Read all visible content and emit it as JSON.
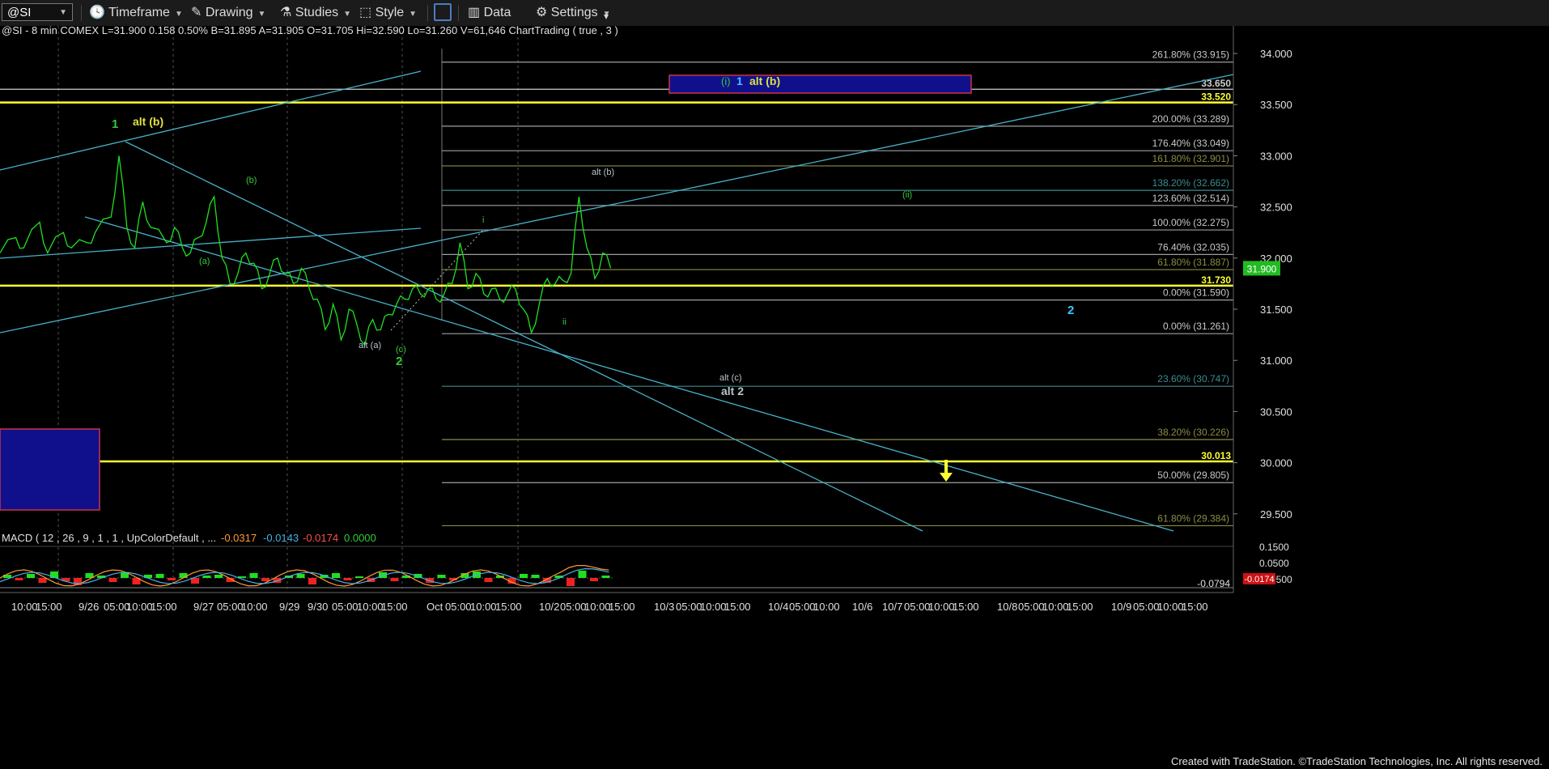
{
  "toolbar": {
    "symbol": "@SI",
    "timeframe": "Timeframe",
    "drawing": "Drawing",
    "studies": "Studies",
    "style": "Style",
    "data": "Data",
    "settings": "Settings"
  },
  "header_line": "@SI - 8 min  COMEX  L=31.900  0.158  0.50%  B=31.895  A=31.905  O=31.705  Hi=32.590  Lo=31.260  V=61,646  ChartTrading ( true , 3 )",
  "macd_header": {
    "label": "MACD ( 12 , 26 , 9 , 1 , 1 , UpColorDefault , ...",
    "v1": "-0.0317",
    "v2": "-0.0143",
    "v3": "-0.0174",
    "v4": "0.0000"
  },
  "footer": "Created with TradeStation. ©TradeStation Technologies, Inc. All rights reserved.",
  "colors": {
    "price": "#1fe01f",
    "trendline": "#48b0c8",
    "support": "#ffff33",
    "fib_grey": "#9aa0a6",
    "fib_olive": "#8c8c44",
    "fib_teal": "#3c8c90",
    "box": "#10108c",
    "wave_green": "#33cc33",
    "wave_yellow": "#e0e040",
    "wave_cyan": "#3cc8ff"
  },
  "chart_data": {
    "type": "line",
    "symbol": "@SI",
    "interval": "8 min",
    "ylim": [
      28.9,
      34.2
    ],
    "price_ticks": [
      34.0,
      33.5,
      33.0,
      32.5,
      32.0,
      31.5,
      31.0,
      30.5,
      30.0,
      29.5
    ],
    "price_tick_labels": [
      "34.000",
      "33.500",
      "33.000",
      "32.500",
      "32.000",
      "31.500",
      "31.000",
      "30.500",
      "30.000",
      "29.500"
    ],
    "x_labels": [
      "10:00",
      "15:00",
      "9/26",
      "05:00",
      "10:00",
      "15:00",
      "9/27",
      "05:00",
      "10:00",
      "9/29",
      "9/30",
      "05:00",
      "10:00",
      "15:00",
      "Oct",
      "05:00",
      "10:00",
      "15:00",
      "10/2",
      "05:00",
      "10:00",
      "15:00",
      "10/3",
      "05:00",
      "10:00",
      "15:00",
      "10/4",
      "05:00",
      "10:00",
      "10/6",
      "10/7",
      "05:00",
      "10:00",
      "15:00",
      "10/8",
      "05:00",
      "10:00",
      "15:00",
      "10/9",
      "05:00",
      "10:00",
      "15:00"
    ],
    "last_price": "31.900",
    "price_series": [
      [
        0,
        32.05
      ],
      [
        2,
        32.2
      ],
      [
        3,
        32.1
      ],
      [
        5,
        32.35
      ],
      [
        6,
        32.05
      ],
      [
        8,
        32.25
      ],
      [
        9,
        32.1
      ],
      [
        11,
        32.15
      ],
      [
        12,
        32.25
      ],
      [
        14,
        32.4
      ],
      [
        15,
        33.0
      ],
      [
        16,
        32.3
      ],
      [
        17,
        32.1
      ],
      [
        18,
        32.55
      ],
      [
        19,
        32.3
      ],
      [
        21,
        32.15
      ],
      [
        22,
        32.3
      ],
      [
        23,
        32.1
      ],
      [
        24,
        32.05
      ],
      [
        25,
        32.2
      ],
      [
        26,
        32.35
      ],
      [
        27,
        32.6
      ],
      [
        28,
        32.0
      ],
      [
        29,
        31.75
      ],
      [
        30,
        31.85
      ],
      [
        31,
        32.05
      ],
      [
        32,
        31.95
      ],
      [
        33,
        31.7
      ],
      [
        34,
        31.85
      ],
      [
        35,
        32.0
      ],
      [
        36,
        31.85
      ],
      [
        37,
        31.75
      ],
      [
        38,
        31.9
      ],
      [
        39,
        31.7
      ],
      [
        40,
        31.6
      ],
      [
        41,
        31.3
      ],
      [
        42,
        31.55
      ],
      [
        43,
        31.2
      ],
      [
        44,
        31.5
      ],
      [
        45,
        31.35
      ],
      [
        46,
        31.15
      ],
      [
        47,
        31.4
      ],
      [
        48,
        31.3
      ],
      [
        49,
        31.45
      ],
      [
        50,
        31.55
      ],
      [
        51,
        31.6
      ],
      [
        52,
        31.7
      ],
      [
        53,
        31.65
      ],
      [
        54,
        31.7
      ],
      [
        55,
        31.6
      ],
      [
        56,
        31.65
      ],
      [
        57,
        31.75
      ],
      [
        58,
        32.15
      ],
      [
        59,
        31.7
      ],
      [
        60,
        31.85
      ],
      [
        61,
        31.65
      ],
      [
        62,
        31.7
      ],
      [
        63,
        31.6
      ],
      [
        64,
        31.65
      ],
      [
        65,
        31.7
      ],
      [
        66,
        31.5
      ],
      [
        67,
        31.27
      ],
      [
        68,
        31.55
      ],
      [
        69,
        31.8
      ],
      [
        70,
        31.75
      ],
      [
        71,
        31.78
      ],
      [
        72,
        31.85
      ],
      [
        73,
        32.6
      ],
      [
        74,
        32.1
      ],
      [
        75,
        31.8
      ],
      [
        76,
        32.05
      ],
      [
        77,
        31.9
      ]
    ],
    "price_series_x_range": [
      0,
      77
    ],
    "fib_levels": [
      {
        "label": "261.80% (33.915)",
        "price": 33.915,
        "color": "grey"
      },
      {
        "label": "200.00% (33.289)",
        "price": 33.289,
        "color": "grey"
      },
      {
        "label": "176.40% (33.049)",
        "price": 33.049,
        "color": "grey"
      },
      {
        "label": "161.80% (32.901)",
        "price": 32.901,
        "color": "olive"
      },
      {
        "label": "138.20% (32.662)",
        "price": 32.662,
        "color": "teal"
      },
      {
        "label": "123.60% (32.514)",
        "price": 32.514,
        "color": "grey"
      },
      {
        "label": "100.00% (32.275)",
        "price": 32.275,
        "color": "grey"
      },
      {
        "label": "76.40% (32.035)",
        "price": 32.035,
        "color": "grey"
      },
      {
        "label": "61.80% (31.887)",
        "price": 31.887,
        "color": "olive"
      },
      {
        "label": "0.00% (31.590)",
        "price": 31.59,
        "color": "grey"
      },
      {
        "label": "0.00% (31.261)",
        "price": 31.261,
        "color": "grey"
      },
      {
        "label": "23.60% (30.747)",
        "price": 30.747,
        "color": "teal"
      },
      {
        "label": "38.20% (30.226)",
        "price": 30.226,
        "color": "olive"
      },
      {
        "label": "50.00% (29.805)",
        "price": 29.805,
        "color": "grey"
      },
      {
        "label": "61.80% (29.384)",
        "price": 29.384,
        "color": "olive"
      }
    ],
    "horizontal_levels": [
      {
        "label": "33.650",
        "price": 33.65,
        "color": "white"
      },
      {
        "label": "33.520",
        "price": 33.52,
        "color": "yellow"
      },
      {
        "label": "31.730",
        "price": 31.73,
        "color": "yellow"
      },
      {
        "label": "30.013",
        "price": 30.013,
        "color": "yellow"
      }
    ],
    "target_box_label": [
      "(i)",
      "1",
      "alt (b)"
    ],
    "wave_labels": [
      {
        "text": "1",
        "color": "green"
      },
      {
        "text": "alt (b)",
        "color": "yellow"
      },
      {
        "text": "(b)",
        "color": "green"
      },
      {
        "text": "(a)",
        "color": "green"
      },
      {
        "text": "alt (a)",
        "color": "grey"
      },
      {
        "text": "(c)",
        "color": "green"
      },
      {
        "text": "2",
        "color": "green"
      },
      {
        "text": "i",
        "color": "green"
      },
      {
        "text": "ii",
        "color": "green"
      },
      {
        "text": "alt (b)",
        "color": "grey"
      },
      {
        "text": "(ii)",
        "color": "green"
      },
      {
        "text": "alt (c)",
        "color": "grey"
      },
      {
        "text": "alt 2",
        "color": "grey"
      },
      {
        "text": "2",
        "color": "cyan"
      }
    ],
    "macd": {
      "yticks": [
        "0.1500",
        "0.0500",
        "-0.0500"
      ],
      "last_low": "-0.0794",
      "last_value": "-0.0174"
    }
  }
}
